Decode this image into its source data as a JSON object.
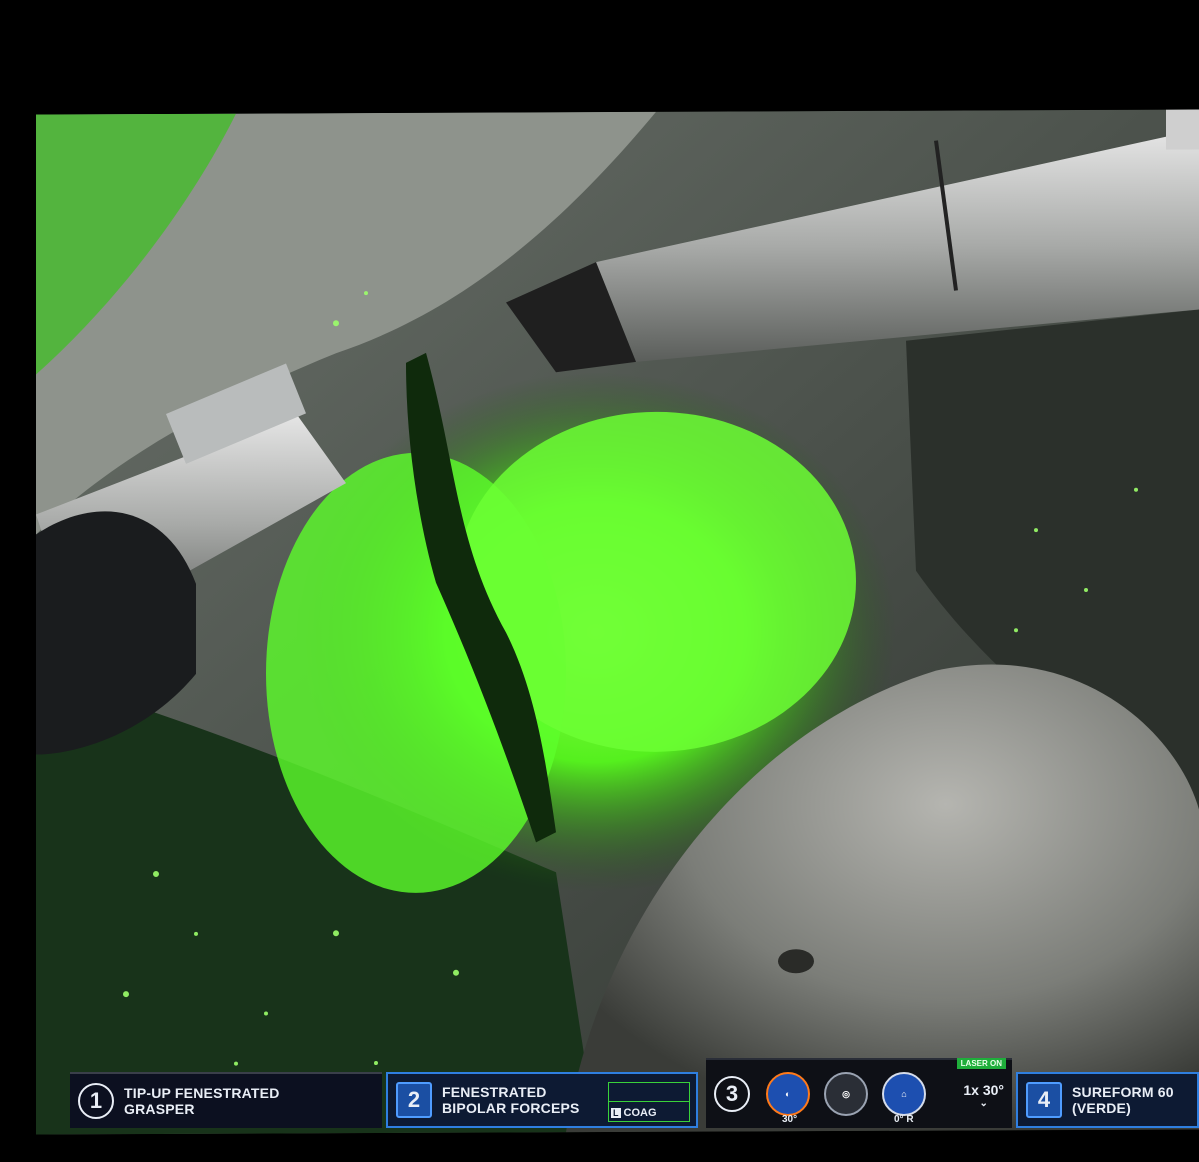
{
  "arms": [
    {
      "number": "1",
      "label": "TIP-UP FENESTRATED\nGRASPER"
    },
    {
      "number": "2",
      "label": "FENESTRATED\nBIPOLAR FORCEPS",
      "energy_pedal": "L",
      "energy_mode": "COAG"
    },
    {
      "number": "3",
      "camera_values": [
        "30°",
        "",
        "0° R"
      ],
      "laser_status": "LASER ON",
      "scope_zoom": "1x",
      "scope_angle": "30°"
    },
    {
      "number": "4",
      "label": "SUREFORM 60\n(VERDE)"
    }
  ],
  "colors": {
    "fluorescence": "#5cff2a",
    "arm_active_border": "#2f7fe0",
    "energy_indicator": "#39d23a",
    "statusbar_bg": "#0c1020"
  },
  "icons": [
    "camera-light-icon",
    "camera-target-icon",
    "camera-orientation-icon",
    "scope-angle-icon"
  ]
}
